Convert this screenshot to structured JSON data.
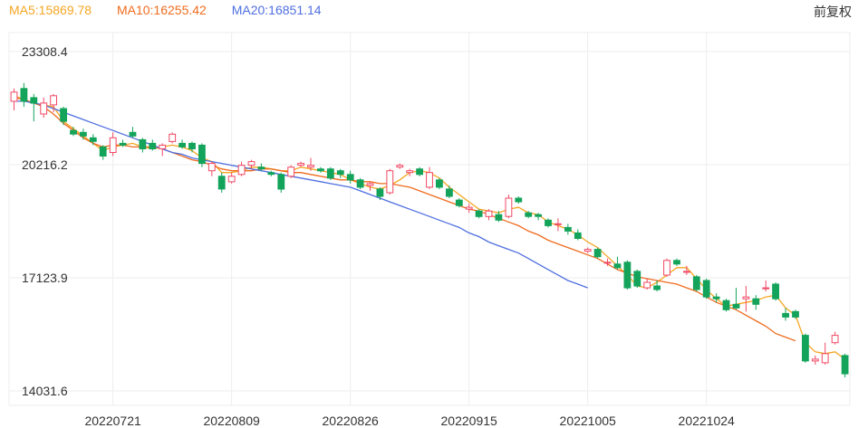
{
  "legend": {
    "ma5": "MA5:15869.78",
    "ma10": "MA10:16255.42",
    "ma20": "MA20:16851.14"
  },
  "adjust_label": "前复权",
  "colors": {
    "up": "#f04864",
    "down": "#13a35a",
    "ma5": "#f5a623",
    "ma10": "#f06b1e",
    "ma20": "#4f6fe0",
    "grid": "#eeeeee",
    "axis_text": "#333333"
  },
  "chart_data": {
    "type": "candlestick",
    "title": "",
    "xlabel": "",
    "ylabel": "",
    "ylim": [
      14031.6,
      23308.4
    ],
    "y_ticks": [
      "23308.4",
      "20216.2",
      "17123.9",
      "14031.6"
    ],
    "y_tick_values": [
      23308.4,
      20216.2,
      17123.9,
      14031.6
    ],
    "x_ticks": [
      {
        "label": "20220721",
        "index": 10
      },
      {
        "label": "20220809",
        "index": 22
      },
      {
        "label": "20220826",
        "index": 34
      },
      {
        "label": "20220915",
        "index": 46
      },
      {
        "label": "20221005",
        "index": 58
      },
      {
        "label": "20221024",
        "index": 70
      }
    ],
    "grid": true,
    "legend_position": "top-left",
    "candles": [
      [
        21950,
        22200,
        22300,
        21700
      ],
      [
        22300,
        21950,
        22450,
        21800
      ],
      [
        22050,
        21900,
        22150,
        21400
      ],
      [
        21600,
        21900,
        22050,
        21500
      ],
      [
        21850,
        22100,
        22150,
        21650
      ],
      [
        21750,
        21400,
        21800,
        21300
      ],
      [
        21150,
        21050,
        21250,
        21000
      ],
      [
        21100,
        21000,
        21200,
        20900
      ],
      [
        20950,
        20850,
        21050,
        20750
      ],
      [
        20700,
        20450,
        20750,
        20350
      ],
      [
        20550,
        20950,
        21100,
        20450
      ],
      [
        20800,
        20750,
        20900,
        20700
      ],
      [
        21100,
        21000,
        21250,
        20950
      ],
      [
        20900,
        20650,
        20950,
        20550
      ],
      [
        20800,
        20650,
        20900,
        20600
      ],
      [
        20650,
        20750,
        20800,
        20450
      ],
      [
        20850,
        21050,
        21100,
        20800
      ],
      [
        20800,
        20700,
        20900,
        20650
      ],
      [
        20800,
        20650,
        20850,
        20550
      ],
      [
        20750,
        20250,
        20800,
        20150
      ],
      [
        20050,
        20250,
        20300,
        19900
      ],
      [
        19900,
        19550,
        20000,
        19450
      ],
      [
        19750,
        19900,
        20000,
        19700
      ],
      [
        19950,
        20200,
        20300,
        19900
      ],
      [
        20200,
        20300,
        20350,
        20100
      ],
      [
        20150,
        20100,
        20250,
        20050
      ],
      [
        20000,
        19950,
        20050,
        19900
      ],
      [
        19950,
        19550,
        20000,
        19450
      ],
      [
        19900,
        20150,
        20200,
        19850
      ],
      [
        20200,
        20250,
        20300,
        20150
      ],
      [
        20150,
        20200,
        20400,
        20050
      ],
      [
        20100,
        20050,
        20150,
        20000
      ],
      [
        20100,
        19850,
        20150,
        19800
      ],
      [
        20050,
        19950,
        20100,
        19850
      ],
      [
        19950,
        19800,
        20050,
        19700
      ],
      [
        19800,
        19600,
        19850,
        19550
      ],
      [
        19650,
        19700,
        19750,
        19500
      ],
      [
        19550,
        19350,
        19600,
        19250
      ],
      [
        19450,
        20050,
        20100,
        19400
      ],
      [
        20150,
        20200,
        20250,
        20100
      ],
      [
        20000,
        20050,
        20100,
        19900
      ],
      [
        20100,
        19950,
        20150,
        19900
      ],
      [
        19600,
        20000,
        20150,
        19550
      ],
      [
        19800,
        19600,
        19850,
        19550
      ],
      [
        19550,
        19350,
        19650,
        19300
      ],
      [
        19250,
        19100,
        19300,
        19050
      ],
      [
        19000,
        19050,
        19150,
        18900
      ],
      [
        18950,
        18800,
        19000,
        18750
      ],
      [
        18800,
        18950,
        19000,
        18700
      ],
      [
        18850,
        18700,
        18950,
        18650
      ],
      [
        18800,
        19300,
        19400,
        18750
      ],
      [
        19300,
        19200,
        19350,
        19150
      ],
      [
        18900,
        18800,
        18950,
        18750
      ],
      [
        18850,
        18800,
        18900,
        18700
      ],
      [
        18700,
        18550,
        18750,
        18500
      ],
      [
        18600,
        18600,
        18750,
        18400
      ],
      [
        18500,
        18400,
        18600,
        18300
      ],
      [
        18350,
        18200,
        18450,
        18150
      ],
      [
        17850,
        17900,
        17950,
        17800
      ],
      [
        17900,
        17700,
        17950,
        17650
      ],
      [
        17550,
        17550,
        17650,
        17450
      ],
      [
        17500,
        17400,
        17700,
        17350
      ],
      [
        17550,
        16850,
        17600,
        16800
      ],
      [
        17300,
        16900,
        17350,
        16850
      ],
      [
        16850,
        17000,
        17100,
        16800
      ],
      [
        16900,
        16800,
        17050,
        16750
      ],
      [
        17200,
        17600,
        17650,
        17150
      ],
      [
        17600,
        17500,
        17650,
        17450
      ],
      [
        17300,
        17300,
        17450,
        17200
      ],
      [
        17150,
        16800,
        17200,
        16750
      ],
      [
        17050,
        16600,
        17100,
        16550
      ],
      [
        16600,
        16550,
        16700,
        16450
      ],
      [
        16500,
        16250,
        16550,
        16200
      ],
      [
        16400,
        16300,
        16850,
        16250
      ],
      [
        16550,
        16600,
        16900,
        16200
      ],
      [
        16550,
        16400,
        16650,
        16250
      ],
      [
        16850,
        16850,
        17050,
        16750
      ],
      [
        16950,
        16550,
        17000,
        16500
      ],
      [
        16150,
        16050,
        16300,
        15950
      ],
      [
        16200,
        16050,
        16250,
        16000
      ],
      [
        15550,
        14850,
        15600,
        14800
      ],
      [
        14850,
        14900,
        15000,
        14750
      ],
      [
        14800,
        15050,
        15350,
        14750
      ],
      [
        15350,
        15550,
        15650,
        15300
      ],
      [
        15000,
        14500,
        15050,
        14400
      ]
    ],
    "series": [
      {
        "name": "MA5",
        "values": [
          22100,
          22000,
          21900,
          21850,
          21800,
          21400,
          21200,
          21000,
          20800,
          20600,
          20700,
          20750,
          20800,
          20700,
          20650,
          20700,
          20750,
          20700,
          20600,
          20400,
          20300,
          20000,
          20000,
          20050,
          20150,
          20150,
          20100,
          20050,
          20050,
          20150,
          20100,
          20050,
          20000,
          19950,
          19800,
          19700,
          19600,
          19550,
          19650,
          19800,
          20000,
          20050,
          20000,
          19850,
          19600,
          19400,
          19200,
          19000,
          18950,
          18900,
          19000,
          19050,
          18900,
          18850,
          18650,
          18550,
          18450,
          18300,
          18100,
          17950,
          17700,
          17450,
          17200,
          16900,
          16850,
          17000,
          17200,
          17400,
          17400,
          17100,
          16800,
          16550,
          16350,
          16400,
          16450,
          16500,
          16600,
          16650,
          16300,
          16100,
          15350,
          15100,
          15050,
          15100,
          14900
        ]
      },
      {
        "name": "MA10",
        "values": [
          22050,
          22000,
          21900,
          21800,
          21600,
          21350,
          21150,
          20950,
          20800,
          20700,
          20750,
          20750,
          20700,
          20700,
          20700,
          20650,
          20550,
          20450,
          20350,
          20300,
          20200,
          20100,
          20050,
          20050,
          20050,
          20100,
          20100,
          20050,
          20000,
          20000,
          19950,
          19900,
          19850,
          19800,
          19800,
          19750,
          19750,
          19700,
          19700,
          19650,
          19600,
          19500,
          19400,
          19300,
          19200,
          19100,
          19000,
          18950,
          18850,
          18750,
          18650,
          18550,
          18400,
          18300,
          18150,
          18050,
          17950,
          17850,
          17750,
          17650,
          17500,
          17350,
          17250,
          17150,
          17100,
          17050,
          17000,
          16950,
          16850,
          16750,
          16600,
          16450,
          16350,
          16250,
          16100,
          15950,
          15800,
          15600,
          15500,
          15400
        ]
      },
      {
        "name": "MA20",
        "values": [
          21950,
          21950,
          21900,
          21850,
          21750,
          21650,
          21550,
          21450,
          21350,
          21250,
          21150,
          21050,
          20950,
          20850,
          20750,
          20650,
          20550,
          20500,
          20400,
          20350,
          20300,
          20250,
          20200,
          20150,
          20100,
          20050,
          20000,
          19950,
          19900,
          19850,
          19800,
          19750,
          19700,
          19650,
          19600,
          19500,
          19400,
          19300,
          19200,
          19100,
          19000,
          18900,
          18800,
          18700,
          18600,
          18500,
          18350,
          18250,
          18100,
          18000,
          17900,
          17800,
          17650,
          17500,
          17350,
          17200,
          17050,
          16950,
          16850
        ]
      }
    ]
  }
}
